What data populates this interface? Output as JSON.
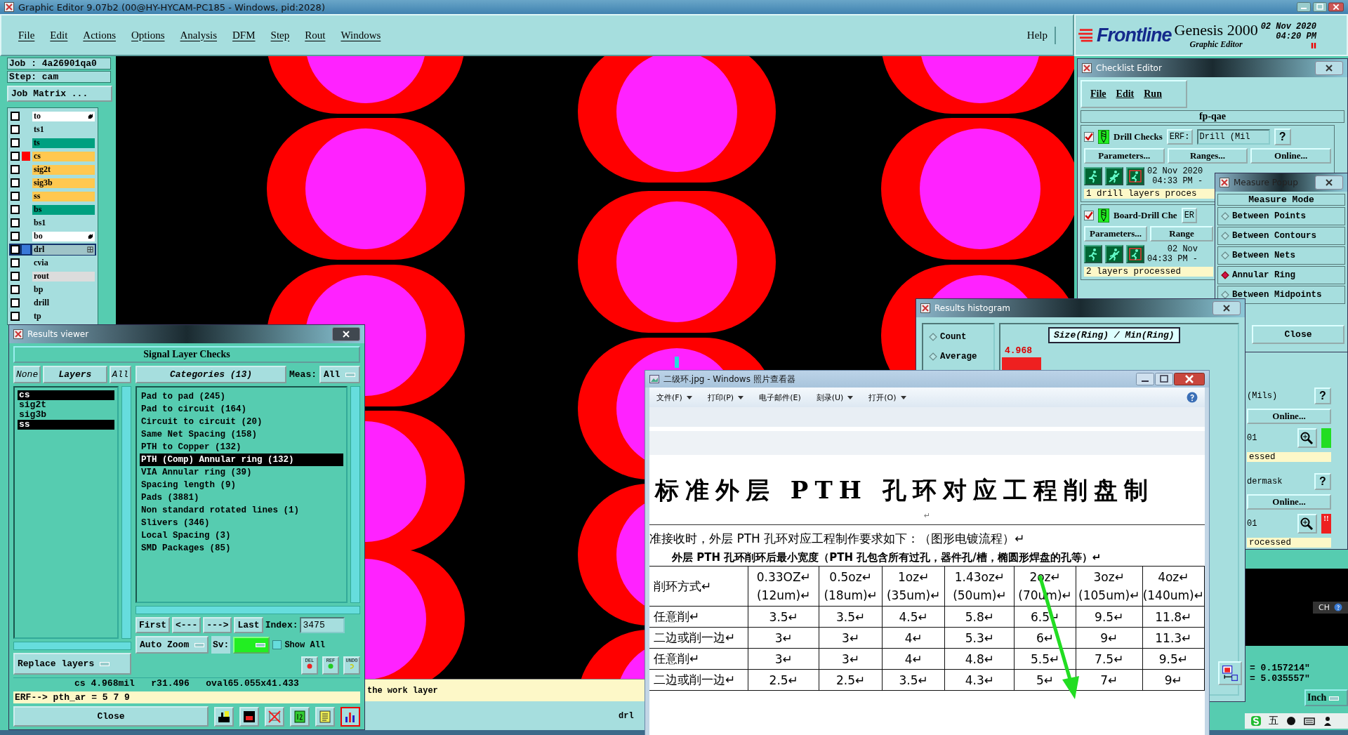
{
  "window": {
    "title": "Graphic Editor 9.07b2 (00@HY-HYCAM-PC185 - Windows, pid:2028)"
  },
  "menu": [
    "File",
    "Edit",
    "Actions",
    "Options",
    "Analysis",
    "DFM",
    "Step",
    "Rout",
    "Windows"
  ],
  "help": "Help",
  "logo": {
    "brand": "Frontline",
    "product": "Genesis 2000",
    "subtitle": "Graphic Editor",
    "date": "02 Nov 2020",
    "time": "04:20 PM"
  },
  "job_panel": {
    "job": "Job : 4a26901qa0",
    "step": "Step: cam",
    "matrix_button": "Job Matrix ...",
    "layers": [
      {
        "name": "to",
        "color": "#ffffff",
        "selected": false,
        "pointer": true
      },
      {
        "name": "ts1",
        "color": "#a6dede",
        "selected": false
      },
      {
        "name": "ts",
        "color": "#00a080",
        "selected": false
      },
      {
        "name": "cs",
        "color": "#ffc850",
        "selected": false,
        "swatch": {
          "color": "#ff0000"
        }
      },
      {
        "name": "sig2t",
        "color": "#ffc850",
        "selected": false
      },
      {
        "name": "sig3b",
        "color": "#ffc850",
        "selected": false
      },
      {
        "name": "ss",
        "color": "#ffc850",
        "selected": false
      },
      {
        "name": "bs",
        "color": "#00a080",
        "selected": false
      },
      {
        "name": "bs1",
        "color": "#a6dede",
        "selected": false
      },
      {
        "name": "bo",
        "color": "#ffffff",
        "selected": false,
        "pointer": true
      },
      {
        "name": "drl",
        "color": "#9fc4c8",
        "selected": true,
        "swatch": {
          "color": "#3a78d8"
        }
      },
      {
        "name": "cvia",
        "color": "#a6dede",
        "selected": false
      },
      {
        "name": "rout",
        "color": "#dcdcdc",
        "selected": false
      },
      {
        "name": "bp",
        "color": "#a6dede",
        "selected": false
      },
      {
        "name": "drill",
        "color": "#a6dede",
        "selected": false
      },
      {
        "name": "tp",
        "color": "#a6dede",
        "selected": false
      }
    ]
  },
  "message_bar": {
    "text": "the work layer",
    "layer": "drl"
  },
  "results_viewer": {
    "title": "Results viewer",
    "heading": "Signal Layer Checks",
    "layer_buttons": [
      "None",
      "Layers",
      "All"
    ],
    "layers": [
      {
        "name": "cs",
        "selected": true
      },
      {
        "name": "sig2t",
        "selected": false
      },
      {
        "name": "sig3b",
        "selected": false
      },
      {
        "name": "ss",
        "selected": true
      }
    ],
    "categories_button": "Categories (13)",
    "meas_label": "Meas:",
    "meas_value": "All",
    "categories": [
      {
        "name": "Pad to pad (245)",
        "selected": false
      },
      {
        "name": "Pad to circuit (164)",
        "selected": false
      },
      {
        "name": "Circuit to circuit (20)",
        "selected": false
      },
      {
        "name": "Same Net Spacing (158)",
        "selected": false
      },
      {
        "name": "PTH to Copper (132)",
        "selected": false
      },
      {
        "name": "PTH (Comp) Annular ring (132)",
        "selected": true
      },
      {
        "name": "VIA Annular ring (39)",
        "selected": false
      },
      {
        "name": "Spacing length (9)",
        "selected": false
      },
      {
        "name": "Pads (3881)",
        "selected": false
      },
      {
        "name": "Non standard rotated lines (1)",
        "selected": false
      },
      {
        "name": "Slivers (346)",
        "selected": false
      },
      {
        "name": "Local Spacing (3)",
        "selected": false
      },
      {
        "name": "SMD Packages (85)",
        "selected": false
      }
    ],
    "nav_buttons": [
      "First",
      "<---",
      "--->",
      "Last"
    ],
    "index_label": "Index:",
    "index_value": "3475",
    "zoom_mode": "Auto Zoom",
    "sv_label": "Sv:",
    "show_all": {
      "label": "Show All",
      "checked": false
    },
    "edit_buttons": [
      "DEL",
      "REF",
      "UNDO"
    ],
    "replace_button": "Replace layers",
    "measurement": "cs 4.968mil   r31.496   oval65.055x41.433",
    "erf": "ERF--> pth_ar = 5 7 9",
    "close": "Close"
  },
  "checklist_editor": {
    "title": "Checklist Editor",
    "menu": [
      "File",
      "Edit",
      "Run"
    ],
    "name": "fp-qae",
    "checks": [
      {
        "name": "Drill Checks",
        "checked": true,
        "erf_label": "ERF:",
        "erf_value": "Drill (Mil",
        "help": "?",
        "buttons": [
          "Parameters...",
          "Ranges...",
          "Online..."
        ],
        "date": "02 Nov 2020",
        "time": "04:33 PM -",
        "status": "1 drill layers proces"
      },
      {
        "name": "Board-Drill Che",
        "checked": true,
        "erf_label": "ER",
        "buttons": [
          "Parameters...",
          "Range"
        ],
        "date": "02 Nov",
        "time": "04:33 PM -",
        "status": "2 layers processed"
      }
    ],
    "partial_checks": [
      {
        "erf_value": "(Mils)",
        "help": "?",
        "button": "Online...",
        "date": "01",
        "status": "essed",
        "ok": true
      },
      {
        "erf_value": "dermask",
        "help": "?",
        "button": "Online...",
        "date": "01",
        "status": "rocessed",
        "ok": false,
        "alert": "!!"
      }
    ]
  },
  "measure_popup": {
    "title": "Measure Popup",
    "heading": "Measure Mode",
    "modes": [
      {
        "label": "Between Points",
        "selected": false
      },
      {
        "label": "Between Contours",
        "selected": false
      },
      {
        "label": "Between Nets",
        "selected": false
      },
      {
        "label": "Annular Ring",
        "selected": true
      },
      {
        "label": "Between Midpoints",
        "selected": false
      }
    ],
    "close": "Close"
  },
  "histogram": {
    "title": "Results histogram",
    "modes": [
      {
        "label": "Count",
        "selected": false
      },
      {
        "label": "Average",
        "selected": false
      }
    ],
    "chart_title": "Size(Ring) / Min(Ring)",
    "bar_label": "4.968"
  },
  "photo_viewer": {
    "title": "二级环.jpg - Windows 照片查看器",
    "menu": [
      {
        "label": "文件(F)",
        "dropdown": true
      },
      {
        "label": "打印(P)",
        "dropdown": true
      },
      {
        "label": "电子邮件(E)",
        "dropdown": false
      },
      {
        "label": "刻录(U)",
        "dropdown": true
      },
      {
        "label": "打开(O)",
        "dropdown": true
      }
    ],
    "document": {
      "heading": "标准外层 PTH 孔环对应工程削盘制",
      "mark": "↵",
      "lead": "准接收时，外层 PTH 孔环对应工程制作要求如下：（图形电镀流程）↵",
      "caption": "外层 PTH 孔环削环后最小宽度（PTH 孔包含所有过孔，器件孔/槽，椭圆形焊盘的孔等）↵",
      "columns": [
        "削环方式↵",
        "0.33OZ↵\n(12um)↵",
        "0.5oz↵\n(18um)↵",
        "1oz↵\n(35um)↵",
        "1.43oz↵\n(50um)↵",
        "2oz↵\n(70um)↵",
        "3oz↵\n(105um)↵",
        "4oz↵\n(140um)↵"
      ],
      "rows": [
        [
          "任意削↵",
          "3.5↵",
          "3.5↵",
          "4.5↵",
          "5.8↵",
          "6.5↵",
          "9.5↵",
          "11.8↵"
        ],
        [
          "二边或削一边↵",
          "3↵",
          "3↵",
          "4↵",
          "5.3↵",
          "6↵",
          "9↵",
          "11.3↵"
        ],
        [
          "任意削↵",
          "3↵",
          "3↵",
          "4↵",
          "4.8↵",
          "5.5↵",
          "7.5↵",
          "9.5↵"
        ],
        [
          "二边或削一边↵",
          "2.5↵",
          "2.5↵",
          "3.5↵",
          "4.3↵",
          "5↵",
          "7↵",
          "9↵"
        ]
      ]
    }
  },
  "right_panel": {
    "ime": "CH",
    "coords": [
      "= 0.157214\"",
      "= 5.035557\""
    ],
    "units": "Inch"
  },
  "ime_bar": {
    "mode": "五"
  }
}
